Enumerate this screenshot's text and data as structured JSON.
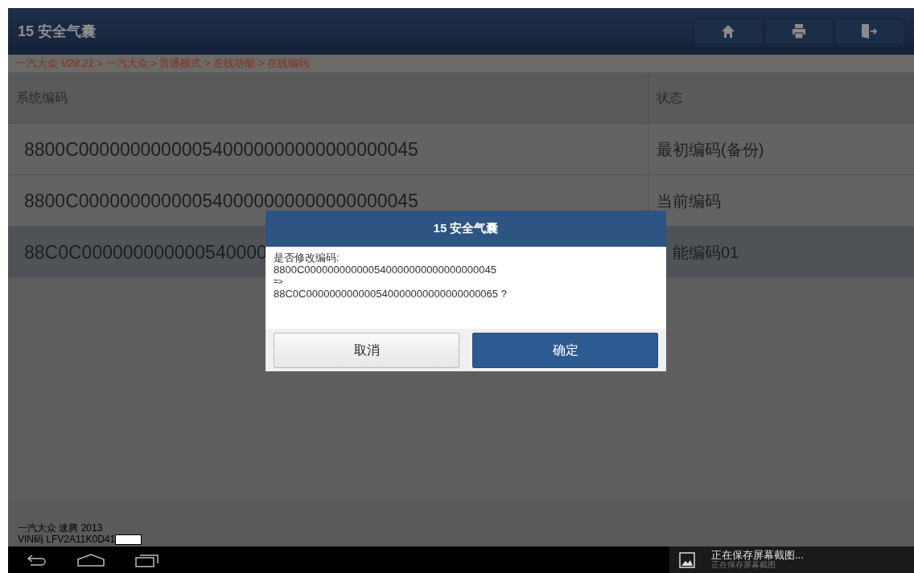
{
  "header": {
    "title": "15 安全气囊",
    "buttons": [
      {
        "kind": "home"
      },
      {
        "kind": "print"
      },
      {
        "kind": "exit"
      }
    ]
  },
  "breadcrumb": "一汽大众 *V28.21* > 一汽大众 > 普通模式 > 在线功能 > 在线编码",
  "table": {
    "columns": [
      "系统编码",
      "状态"
    ],
    "rows": [
      {
        "code": "8800C000000000000540000000000000000045",
        "status": "最初编码(备份)",
        "selected": false
      },
      {
        "code": "8800C000000000000540000000000000000045",
        "status": "当前编码",
        "selected": false
      },
      {
        "code": "88C0C000000000000540000",
        "status": "能编码01",
        "selected": true
      }
    ]
  },
  "dialog": {
    "title": "15 安全气囊",
    "lines": [
      "是否修改编码:",
      "8800C000000000000540000000000000000045",
      "=>",
      "88C0C000000000000540000000000000000065 ?"
    ],
    "buttons": [
      {
        "label": "取消",
        "primary": false
      },
      {
        "label": "确定",
        "primary": true
      }
    ]
  },
  "footer": {
    "vehicle": "一汽大众 速腾 2013",
    "vin": "VIN码 LFV2A11K0D41"
  },
  "notification": {
    "title": "正在保存屏幕截图...",
    "subtitle": "正在保存屏幕截图"
  }
}
